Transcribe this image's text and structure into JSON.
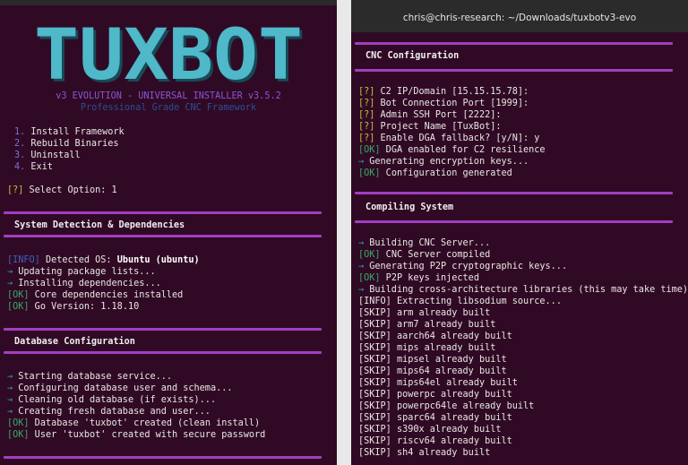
{
  "left": {
    "logo_text": "TUXBOT",
    "version": "v3 EVOLUTION - UNIVERSAL INSTALLER  v3.5.2",
    "subtitle": "Professional Grade CNC Framework",
    "menu": [
      {
        "num": "1.",
        "label": "Install Framework"
      },
      {
        "num": "2.",
        "label": "Rebuild Binaries"
      },
      {
        "num": "3.",
        "label": "Uninstall"
      },
      {
        "num": "4.",
        "label": "Exit"
      }
    ],
    "select_tag": "[?]",
    "select_text": " Select Option: 1",
    "section1_title": "System Detection & Dependencies",
    "section1_lines": [
      {
        "tag": "[INFO]",
        "kind": "info",
        "text": " Detected OS: ",
        "bold": "Ubuntu (ubuntu)"
      },
      {
        "tag": "→",
        "kind": "arrow",
        "text": " Updating package lists...",
        "bold": ""
      },
      {
        "tag": "→",
        "kind": "arrow",
        "text": " Installing dependencies...",
        "bold": ""
      },
      {
        "tag": "[OK]",
        "kind": "ok",
        "text": " Core dependencies installed",
        "bold": ""
      },
      {
        "tag": "[OK]",
        "kind": "ok",
        "text": " Go Version: 1.18.10",
        "bold": ""
      }
    ],
    "section2_title": "Database Configuration",
    "section2_lines": [
      {
        "tag": "→",
        "kind": "arrow",
        "text": " Starting database service..."
      },
      {
        "tag": "→",
        "kind": "arrow",
        "text": " Configuring database user and schema..."
      },
      {
        "tag": "→",
        "kind": "arrow",
        "text": " Cleaning old database (if exists)..."
      },
      {
        "tag": "→",
        "kind": "arrow",
        "text": " Creating fresh database and user..."
      },
      {
        "tag": "[OK]",
        "kind": "ok",
        "text": " Database 'tuxbot' created (clean install)"
      },
      {
        "tag": "[OK]",
        "kind": "ok",
        "text": " User 'tuxbot' created with secure password"
      }
    ]
  },
  "right": {
    "window_title": "chris@chris-research: ~/Downloads/tuxbotv3-evo",
    "section1_title": "CNC Configuration",
    "section1_lines": [
      {
        "tag": "[?]",
        "kind": "q",
        "text": " C2 IP/Domain [15.15.15.78]:"
      },
      {
        "tag": "[?]",
        "kind": "q",
        "text": " Bot Connection Port [1999]:"
      },
      {
        "tag": "[?]",
        "kind": "q",
        "text": " Admin SSH Port [2222]:"
      },
      {
        "tag": "[?]",
        "kind": "q",
        "text": " Project Name [TuxBot]:"
      },
      {
        "tag": "[?]",
        "kind": "q",
        "text": " Enable DGA fallback? [y/N]: y"
      },
      {
        "tag": "[OK]",
        "kind": "ok",
        "text": " DGA enabled for C2 resilience"
      },
      {
        "tag": "→",
        "kind": "arrow",
        "text": " Generating encryption keys..."
      },
      {
        "tag": "[OK]",
        "kind": "ok",
        "text": " Configuration generated"
      }
    ],
    "section2_title": "Compiling System",
    "section2_lines": [
      {
        "tag": "→",
        "kind": "arrow",
        "text": " Building CNC Server..."
      },
      {
        "tag": "[OK]",
        "kind": "ok",
        "text": " CNC Server compiled"
      },
      {
        "tag": "→",
        "kind": "arrow",
        "text": " Generating P2P cryptographic keys..."
      },
      {
        "tag": "[OK]",
        "kind": "ok",
        "text": " P2P keys injected"
      },
      {
        "tag": "→",
        "kind": "arrow",
        "text": " Building cross-architecture libraries (this may take time)..."
      },
      {
        "tag": "[INFO]",
        "kind": "plain",
        "text": " Extracting libsodium source..."
      },
      {
        "tag": "[SKIP]",
        "kind": "plain",
        "text": " arm already built"
      },
      {
        "tag": "[SKIP]",
        "kind": "plain",
        "text": " arm7 already built"
      },
      {
        "tag": "[SKIP]",
        "kind": "plain",
        "text": " aarch64 already built"
      },
      {
        "tag": "[SKIP]",
        "kind": "plain",
        "text": " mips already built"
      },
      {
        "tag": "[SKIP]",
        "kind": "plain",
        "text": " mipsel already built"
      },
      {
        "tag": "[SKIP]",
        "kind": "plain",
        "text": " mips64 already built"
      },
      {
        "tag": "[SKIP]",
        "kind": "plain",
        "text": " mips64el already built"
      },
      {
        "tag": "[SKIP]",
        "kind": "plain",
        "text": " powerpc already built"
      },
      {
        "tag": "[SKIP]",
        "kind": "plain",
        "text": " powerpc64le already built"
      },
      {
        "tag": "[SKIP]",
        "kind": "plain",
        "text": " sparc64 already built"
      },
      {
        "tag": "[SKIP]",
        "kind": "plain",
        "text": " s390x already built"
      },
      {
        "tag": "[SKIP]",
        "kind": "plain",
        "text": " riscv64 already built"
      },
      {
        "tag": "[SKIP]",
        "kind": "plain",
        "text": " sh4 already built"
      }
    ]
  },
  "colors": {
    "terminal_bg": "#300a24",
    "rule": "#a23ec2",
    "logo": "#4fb8c9",
    "ok": "#37a86a",
    "info": "#3e63bf",
    "question": "#c7bf3a",
    "arrow": "#2fa7c7"
  }
}
